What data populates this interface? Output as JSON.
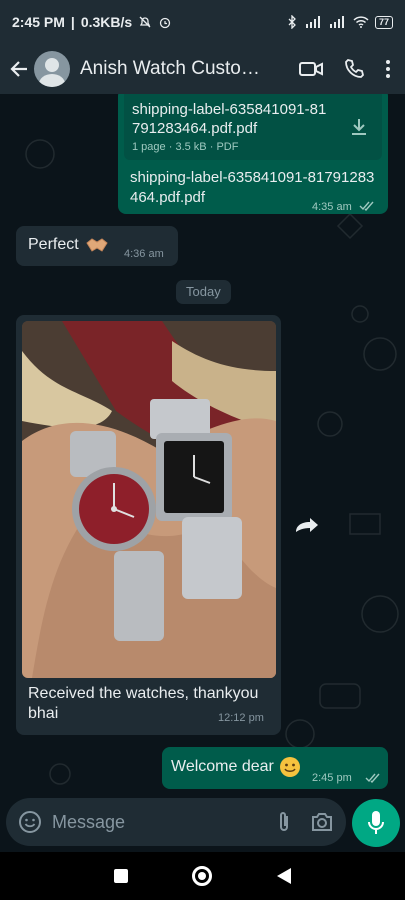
{
  "status_bar": {
    "time": "2:45 PM",
    "net_speed": "0.3KB/s",
    "battery": "77"
  },
  "header": {
    "contact_name": "Anish Watch Customer",
    "icons": [
      "back-arrow-icon",
      "avatar",
      "video-call-icon",
      "phone-icon",
      "more-vert-icon"
    ]
  },
  "messages": {
    "doc": {
      "file_name": "shipping-label-635841091-81791283464.pdf.pdf",
      "pages": "1 page",
      "size": "3.5 kB",
      "type": "PDF",
      "caption": "shipping-label-635841091-81791283464.pdf.pdf",
      "time": "4:35 am"
    },
    "perfect": {
      "text": "Perfect",
      "time": "4:36 am"
    },
    "day_separator": "Today",
    "photo_msg": {
      "caption": "Received the watches, thankyou bhai",
      "time": "12:12 pm"
    },
    "welcome": {
      "text": "Welcome dear",
      "time": "2:45 pm"
    }
  },
  "composer": {
    "placeholder": "Message"
  },
  "colors": {
    "outgoing_bubble": "#005c4b",
    "incoming_bubble": "#1f2c34",
    "accent": "#00a884",
    "background": "#0b141a"
  }
}
